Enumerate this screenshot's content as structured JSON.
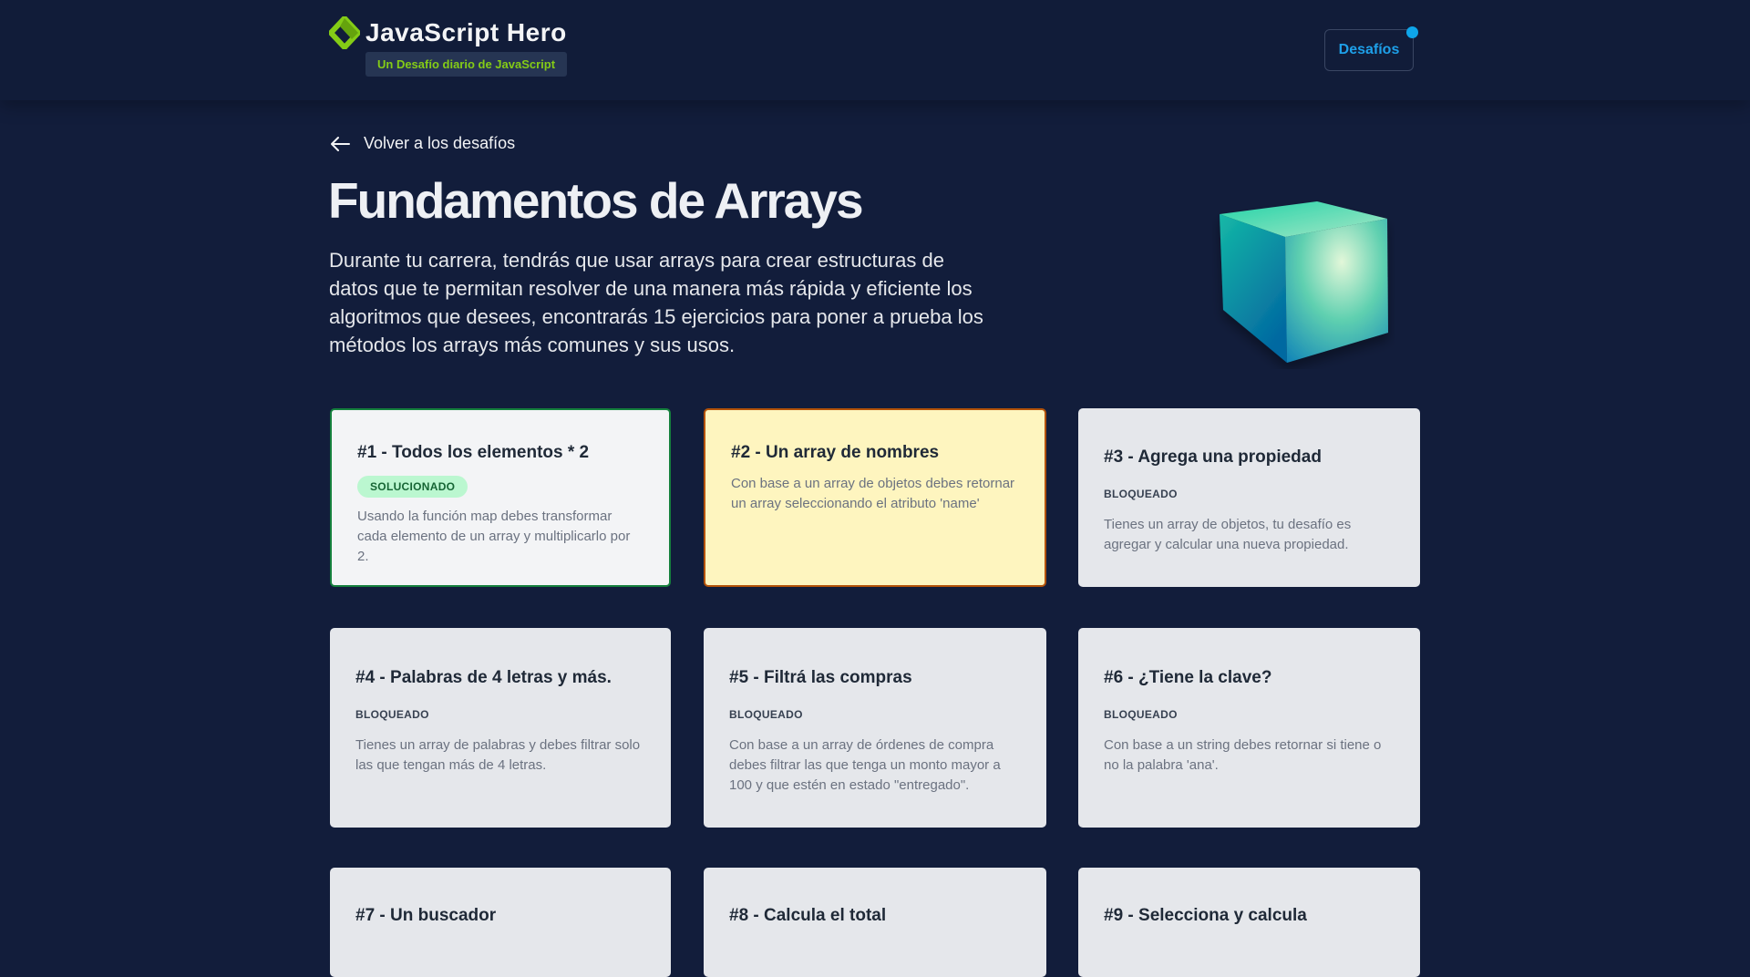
{
  "header": {
    "brand_title": "JavaScript Hero",
    "brand_subtitle": "Un Desafío diario de JavaScript",
    "nav_button": "Desafíos",
    "accent_green": "#84cc16",
    "accent_blue": "#1ea0e9",
    "logo_icon": "diamond-logo-icon"
  },
  "back": {
    "label": "Volver a los desafíos",
    "icon": "arrow-left-icon"
  },
  "page": {
    "title": "Fundamentos de Arrays",
    "description": "Durante tu carrera, tendrás que usar arrays para crear estructuras de datos que te permitan resolver de una manera más rápida y eficiente los algoritmos que desees, encontrarás 15 ejercicios para poner a prueba los métodos los arrays más comunes y sus usos.",
    "hero_icon": "gradient-cube-icon"
  },
  "cards": [
    {
      "title": "#1 - Todos los elementos * 2",
      "status": "SOLUCIONADO",
      "description": "Usando la función map debes transformar cada elemento de un array y multiplicarlo por 2."
    },
    {
      "title": "#2 - Un array de nombres",
      "status": "",
      "description": "Con base a un array de objetos debes retornar un array seleccionando el atributo 'name'"
    },
    {
      "title": "#3 - Agrega una propiedad",
      "status": "BLOQUEADO",
      "description": "Tienes un array de objetos, tu desafío es agregar y calcular una nueva propiedad."
    },
    {
      "title": "#4 - Palabras de 4 letras y más.",
      "status": "BLOQUEADO",
      "description": "Tienes un array de palabras y debes filtrar solo las que tengan más de 4 letras."
    },
    {
      "title": "#5 - Filtrá las compras",
      "status": "BLOQUEADO",
      "description": "Con base a un array de órdenes de compra debes filtrar las que tenga un monto mayor a 100 y que estén en estado \"entregado\"."
    },
    {
      "title": "#6 - ¿Tiene la clave?",
      "status": "BLOQUEADO",
      "description": "Con base a un string debes retornar si tiene o no la palabra 'ana'."
    },
    {
      "title": "#7 - Un buscador",
      "status": "",
      "description": ""
    },
    {
      "title": "#8 - Calcula el total",
      "status": "",
      "description": ""
    },
    {
      "title": "#9 - Selecciona y calcula",
      "status": "",
      "description": ""
    }
  ]
}
